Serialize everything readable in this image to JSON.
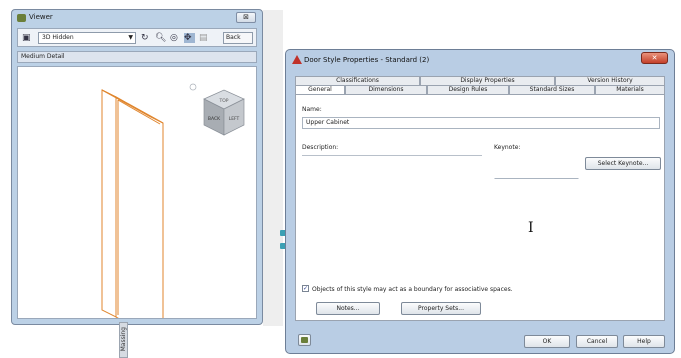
{
  "viewer": {
    "title": "Viewer",
    "close_label": "⊠",
    "visual_style": "3D Hidden",
    "back_label": "Back",
    "detail_level": "Medium Detail",
    "viewcube_faces": {
      "top": "TOP",
      "left": "BACK",
      "right": "LEFT"
    }
  },
  "side_tab": {
    "label": "Massing"
  },
  "dialog": {
    "title": "Door Style Properties - Standard (2)",
    "close_label": "✕",
    "tabs_back": [
      "Classifications",
      "Display Properties",
      "Version History"
    ],
    "tabs_front": [
      "General",
      "Dimensions",
      "Design Rules",
      "Standard Sizes",
      "Materials"
    ],
    "active_tab": "General",
    "name_label": "Name:",
    "name_value": "Upper Cabinet",
    "description_label": "Description:",
    "keynote_label": "Keynote:",
    "select_keynote_label": "Select Keynote...",
    "boundary_checkbox_label": "Objects of this style may act as a boundary for associative spaces.",
    "boundary_checked": true,
    "notes_label": "Notes...",
    "property_sets_label": "Property Sets...",
    "ok_label": "OK",
    "cancel_label": "Cancel",
    "help_label": "Help"
  },
  "colors": {
    "window_frame": "#bcd1e6",
    "door_outline": "#e0862e",
    "close_red": "#c4402a"
  }
}
